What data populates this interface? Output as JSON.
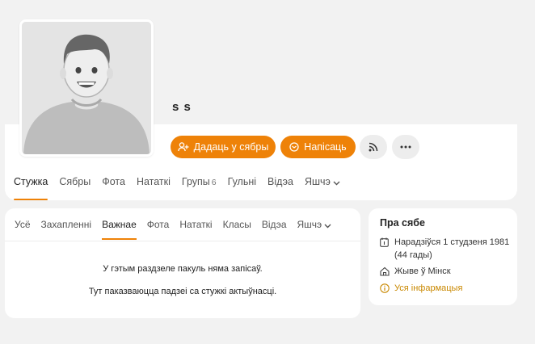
{
  "profile": {
    "name": "s s",
    "add_friend_label": "Дадаць у сябры",
    "write_label": "Напісаць"
  },
  "tabs": [
    {
      "label": "Стужка",
      "active": true
    },
    {
      "label": "Сябры"
    },
    {
      "label": "Фота"
    },
    {
      "label": "Нататкі"
    },
    {
      "label": "Групы",
      "count": "6"
    },
    {
      "label": "Гульні"
    },
    {
      "label": "Відэа"
    },
    {
      "label": "Яшчэ"
    }
  ],
  "feed": {
    "subtabs": [
      {
        "label": "Усё"
      },
      {
        "label": "Захапленні"
      },
      {
        "label": "Важнае",
        "active": true
      },
      {
        "label": "Фота"
      },
      {
        "label": "Нататкі"
      },
      {
        "label": "Класы"
      },
      {
        "label": "Відэа"
      },
      {
        "label": "Яшчэ"
      }
    ],
    "empty_line1": "У гэтым раздзеле пакуль няма запісаў.",
    "empty_line2": "Тут паказваюцца падзеі са стужкі актыўнасці."
  },
  "about": {
    "title": "Пра сябе",
    "birthday_line1": "Нарадзіўся 1 студзеня 1981",
    "birthday_line2": "(44 гады)",
    "lives": "Жыве ў Мінск",
    "more_info": "Уся інфармацыя"
  },
  "colors": {
    "accent": "#ee8208",
    "link": "#c98800"
  },
  "icons": [
    "add-friend-icon",
    "message-icon",
    "rss-icon",
    "more-icon",
    "chevron-down-icon",
    "calendar-icon",
    "home-icon",
    "info-icon"
  ]
}
